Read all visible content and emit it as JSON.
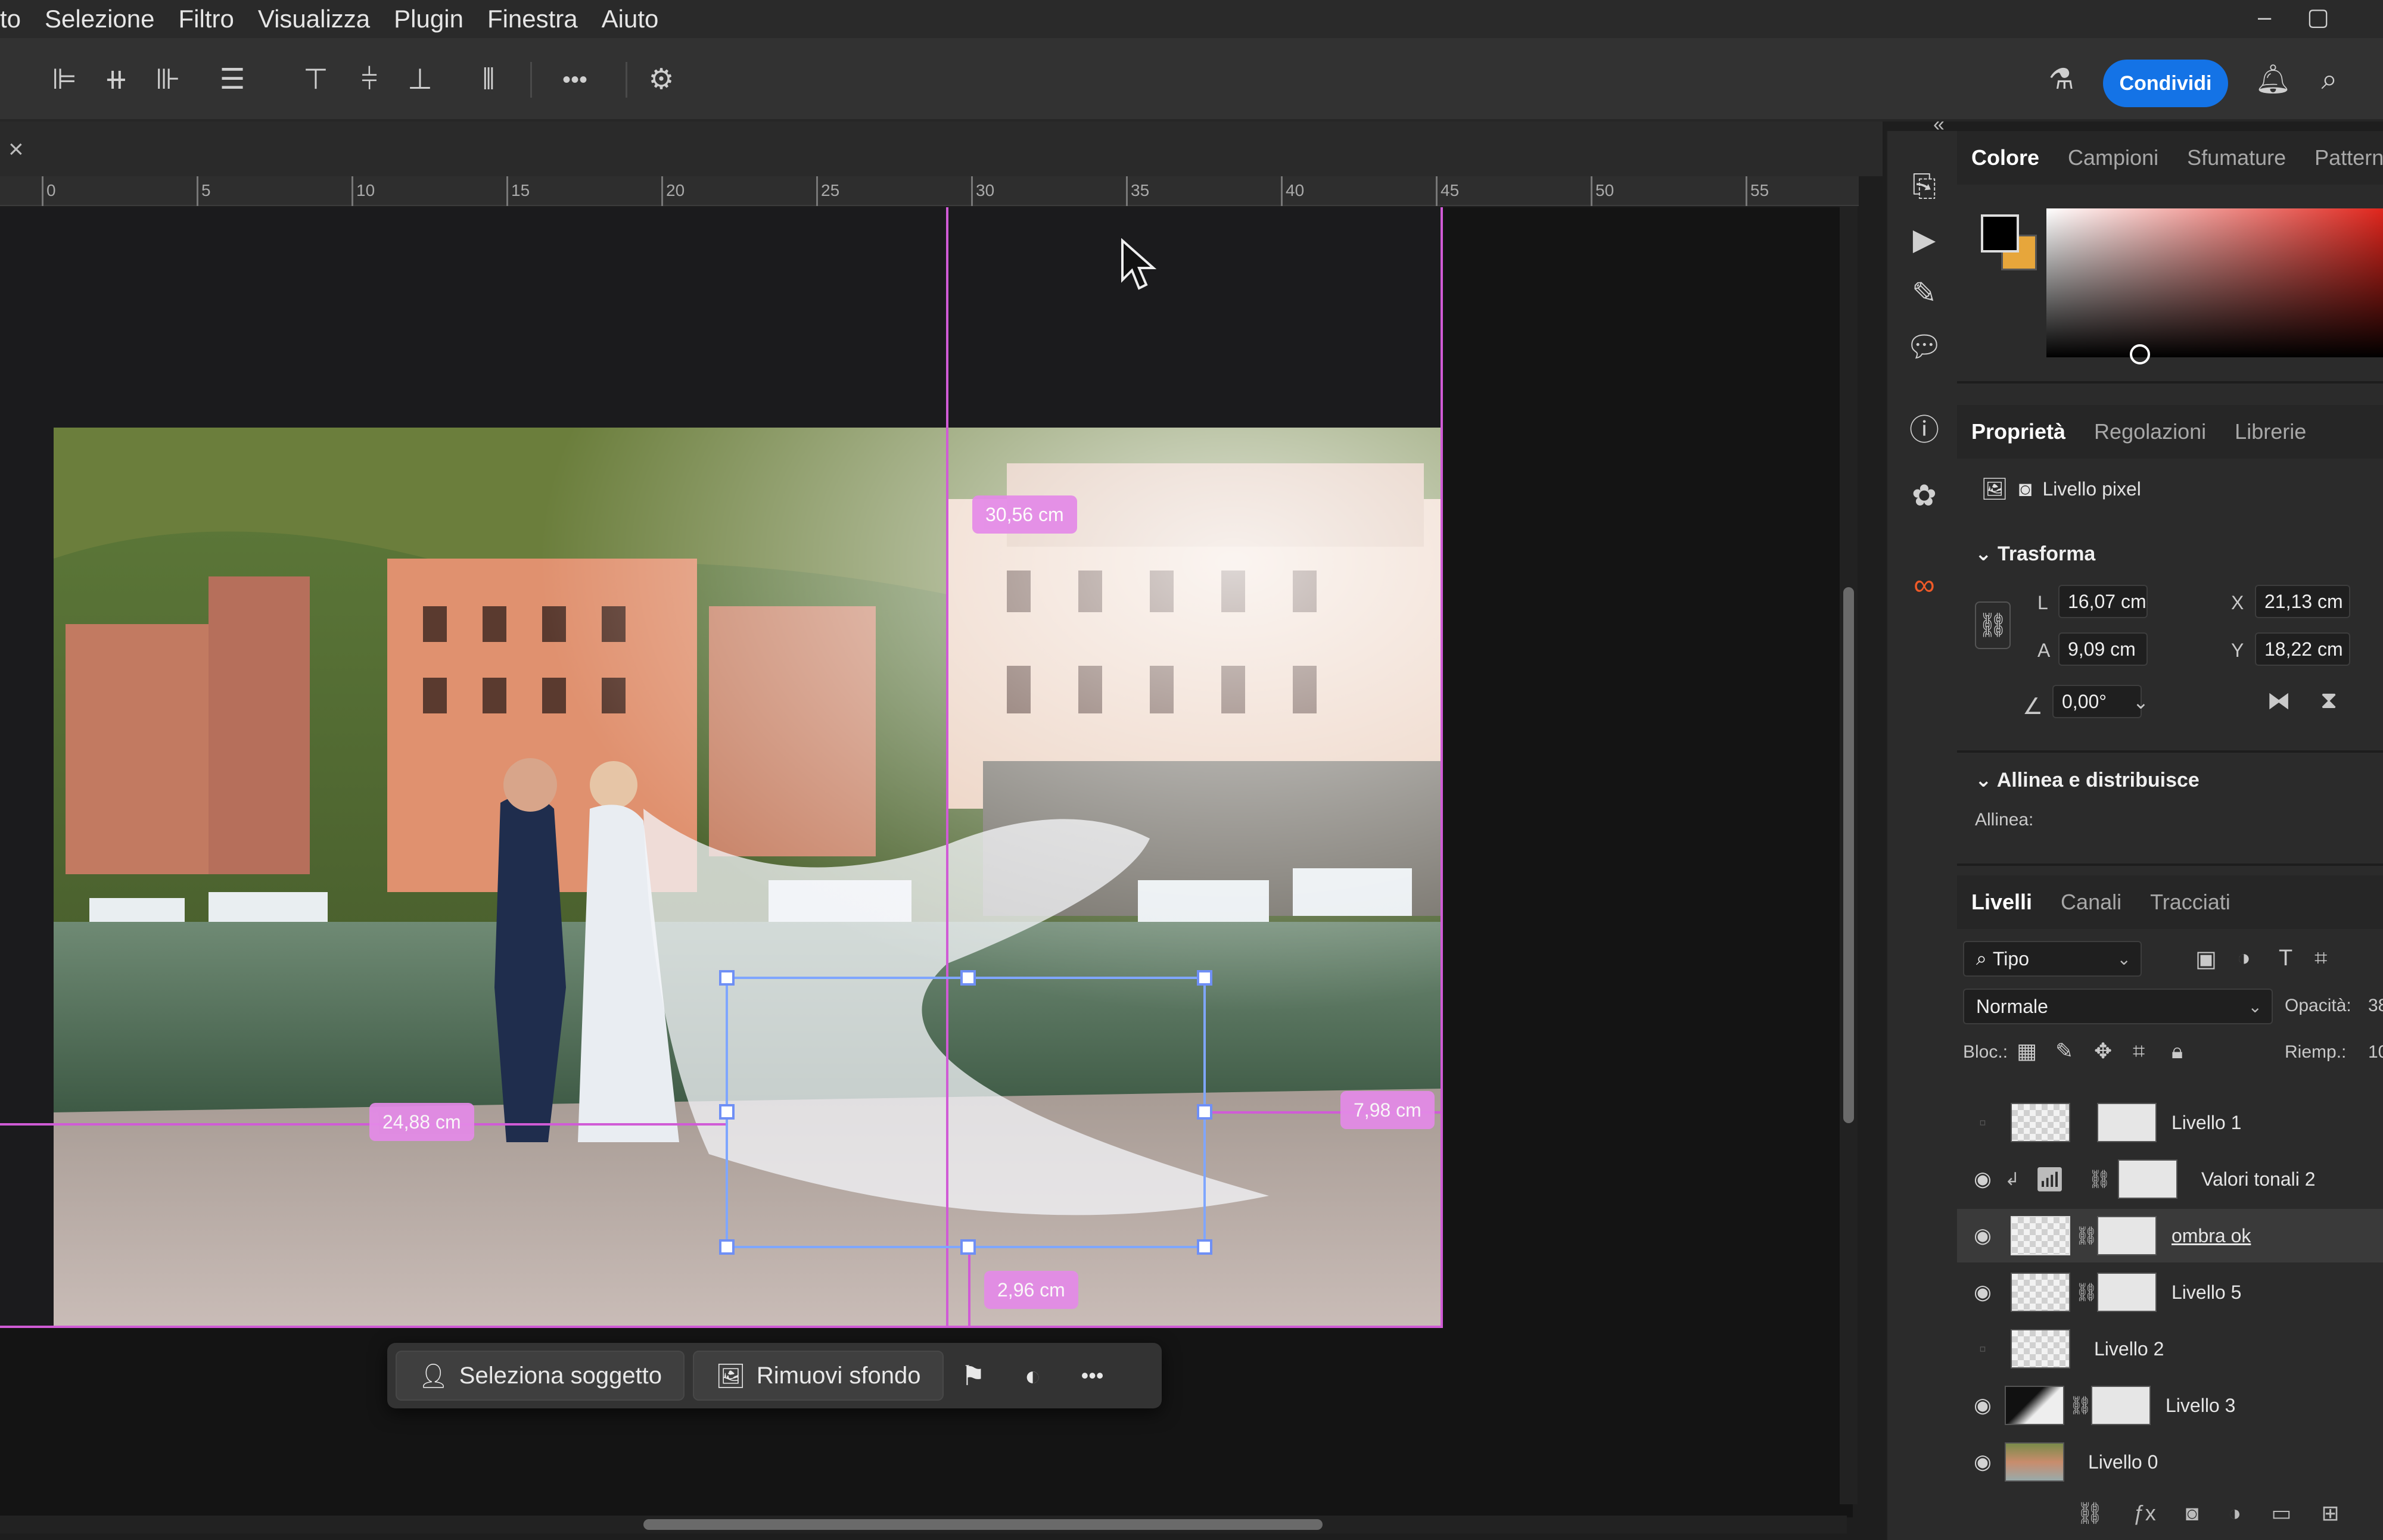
{
  "menu": [
    "to",
    "Selezione",
    "Filtro",
    "Visualizza",
    "Plugin",
    "Finestra",
    "Aiuto"
  ],
  "options_bar": {
    "more_glyph": "•••",
    "share_label": "Condividi"
  },
  "ruler": {
    "labels": [
      "0",
      "5",
      "10",
      "15",
      "20",
      "25",
      "30",
      "35",
      "40",
      "45",
      "50",
      "55"
    ]
  },
  "canvas": {
    "measure_top": "30,56 cm",
    "measure_left": "24,88 cm",
    "measure_right": "7,98 cm",
    "measure_bottom": "2,96 cm"
  },
  "taskbar": {
    "select_subject": "Seleziona soggetto",
    "remove_bg": "Rimuovi sfondo",
    "more_glyph": "•••"
  },
  "color_panel": {
    "tabs": [
      "Colore",
      "Campioni",
      "Sfumature",
      "Pattern"
    ],
    "foreground": "#000000",
    "background": "#e7a63b"
  },
  "properties_panel": {
    "tabs": [
      "Proprietà",
      "Regolazioni",
      "Librerie"
    ],
    "layer_kind": "Livello pixel",
    "transform_title": "Trasforma",
    "w_label": "L",
    "w_value": "16,07 cm",
    "h_label": "A",
    "h_value": "9,09 cm",
    "x_label": "X",
    "x_value": "21,13 cm",
    "y_label": "Y",
    "y_value": "18,22 cm",
    "angle_value": "0,00°",
    "align_title": "Allinea e distribuisce",
    "align_label": "Allinea:"
  },
  "layers_panel": {
    "tabs": [
      "Livelli",
      "Canali",
      "Tracciati"
    ],
    "filter_type": "Tipo",
    "blend_mode": "Normale",
    "opacity_label": "Opacità:",
    "opacity_value": "38",
    "lock_label": "Bloc.:",
    "fill_label": "Riemp.:",
    "fill_value": "10",
    "layers": [
      {
        "name": "Livello 1"
      },
      {
        "name": "Valori tonali 2"
      },
      {
        "name": "ombra ok"
      },
      {
        "name": "Livello 5"
      },
      {
        "name": "Livello 2"
      },
      {
        "name": "Livello 3"
      },
      {
        "name": "Livello 0"
      }
    ]
  }
}
